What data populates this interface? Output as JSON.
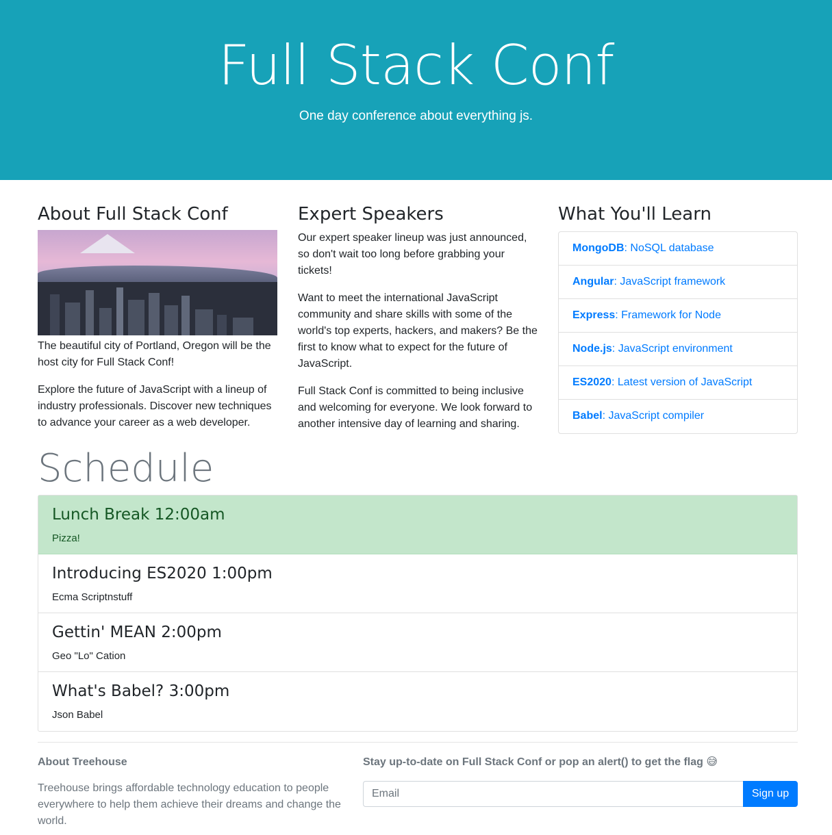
{
  "hero": {
    "title": "Full Stack Conf",
    "subtitle": "One day conference about everything js."
  },
  "about": {
    "heading": "About Full Stack Conf",
    "paragraphs": [
      "The beautiful city of Portland, Oregon will be the host city for Full Stack Conf!",
      "Explore the future of JavaScript with a lineup of industry professionals. Discover new techniques to advance your career as a web developer."
    ]
  },
  "speakers": {
    "heading": "Expert Speakers",
    "paragraphs": [
      "Our expert speaker lineup was just announced, so don't wait too long before grabbing your tickets!",
      "Want to meet the international JavaScript community and share skills with some of the world's top experts, hackers, and makers? Be the first to know what to expect for the future of JavaScript.",
      "Full Stack Conf is committed to being inclusive and welcoming for everyone. We look forward to another intensive day of learning and sharing."
    ]
  },
  "learn": {
    "heading": "What You'll Learn",
    "items": [
      {
        "name": "MongoDB",
        "desc": ": NoSQL database"
      },
      {
        "name": "Angular",
        "desc": ": JavaScript framework"
      },
      {
        "name": "Express",
        "desc": ": Framework for Node"
      },
      {
        "name": "Node.js",
        "desc": ": JavaScript environment"
      },
      {
        "name": "ES2020",
        "desc": ": Latest version of JavaScript"
      },
      {
        "name": "Babel",
        "desc": ": JavaScript compiler"
      }
    ]
  },
  "schedule": {
    "heading": "Schedule",
    "items": [
      {
        "title": "Lunch Break 12:00am",
        "speaker": "Pizza!"
      },
      {
        "title": "Introducing ES2020 1:00pm",
        "speaker": "Ecma Scriptnstuff"
      },
      {
        "title": "Gettin' MEAN 2:00pm",
        "speaker": "Geo \"Lo\" Cation"
      },
      {
        "title": "What's Babel? 3:00pm",
        "speaker": "Json Babel"
      }
    ]
  },
  "footer": {
    "about_heading": "About Treehouse",
    "about_text": "Treehouse brings affordable technology education to people everywhere to help them achieve their dreams and change the world.",
    "signup_heading": "Stay up-to-date on Full Stack Conf or pop an alert() to get the flag 😅",
    "email_placeholder": "Email",
    "signup_button": "Sign up"
  },
  "colors": {
    "hero_bg": "#17a2b8",
    "link": "#007bff",
    "active_item_bg": "#c3e6cb",
    "active_item_text": "#155724"
  }
}
